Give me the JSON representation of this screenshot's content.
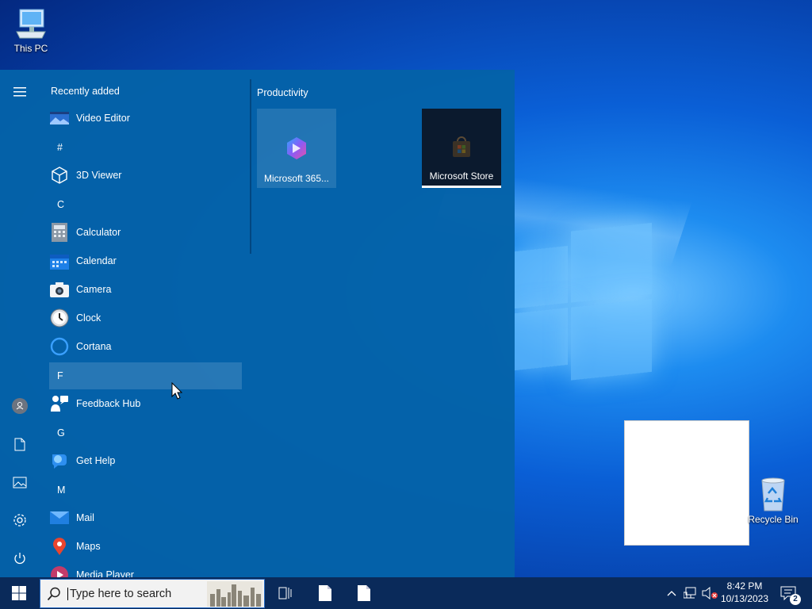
{
  "desktop": {
    "icons": [
      {
        "label": "This PC",
        "icon": "computer-icon"
      },
      {
        "label": "Recycle Bin",
        "icon": "recycle-bin-icon"
      }
    ]
  },
  "start_menu": {
    "section_title": "Recently added",
    "recent": {
      "label": "Video Editor",
      "icon": "video-editor-icon"
    },
    "groups": [
      {
        "letter": "#",
        "apps": [
          {
            "label": "3D Viewer",
            "icon": "cube-icon"
          }
        ]
      },
      {
        "letter": "C",
        "apps": [
          {
            "label": "Calculator",
            "icon": "calculator-icon"
          },
          {
            "label": "Calendar",
            "icon": "calendar-icon"
          },
          {
            "label": "Camera",
            "icon": "camera-icon"
          },
          {
            "label": "Clock",
            "icon": "clock-icon"
          },
          {
            "label": "Cortana",
            "icon": "cortana-icon"
          }
        ]
      },
      {
        "letter": "F",
        "apps": [
          {
            "label": "Feedback Hub",
            "icon": "feedback-hub-icon"
          }
        ]
      },
      {
        "letter": "G",
        "apps": [
          {
            "label": "Get Help",
            "icon": "help-icon"
          }
        ]
      },
      {
        "letter": "M",
        "apps": [
          {
            "label": "Mail",
            "icon": "mail-icon"
          },
          {
            "label": "Maps",
            "icon": "map-pin-icon"
          },
          {
            "label": "Media Player",
            "icon": "media-player-icon"
          }
        ]
      }
    ],
    "tiles_section": "Productivity",
    "tiles": [
      {
        "label": "Microsoft 365...",
        "icon": "microsoft-365-icon"
      },
      {
        "label": "Microsoft Store",
        "icon": "store-bag-icon"
      }
    ],
    "rail_icons": [
      "hamburger-menu-icon",
      "user-icon",
      "documents-icon",
      "pictures-icon",
      "settings-icon",
      "power-icon"
    ]
  },
  "taskbar": {
    "search_placeholder": "Type here to search",
    "clock": {
      "time": "8:42 PM",
      "date": "10/13/2023"
    },
    "notification_count": "2"
  },
  "colors": {
    "start_bg": "#0462a8",
    "taskbar_bg": "#0a2a5a"
  }
}
